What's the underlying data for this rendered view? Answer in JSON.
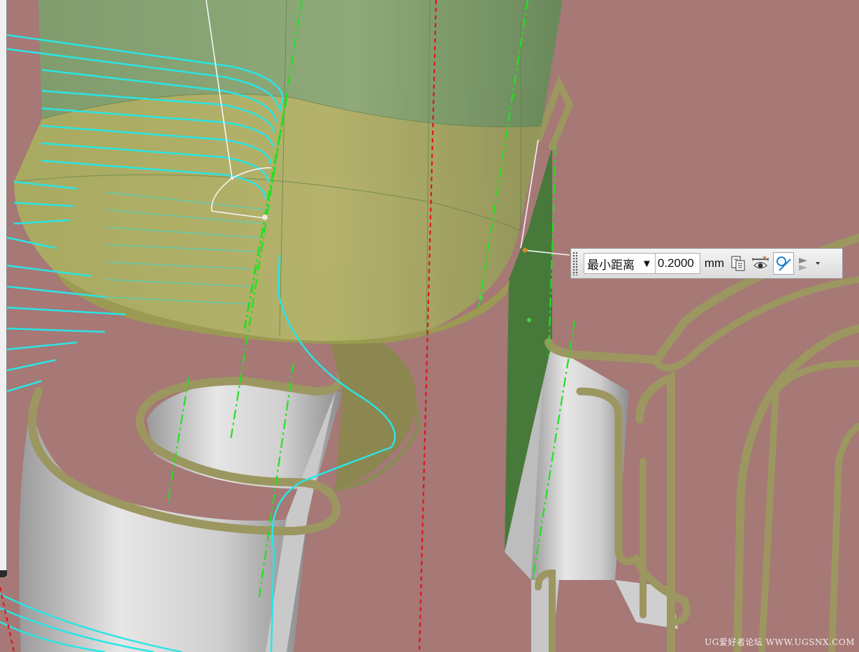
{
  "toolbar": {
    "measure_type": "最小距离",
    "measure_value": "0.2000",
    "unit": "mm",
    "icons": [
      "grip-icon",
      "clipboard-icon",
      "show-hide-icon",
      "measure-arc-icon",
      "options-dropdown-icon"
    ]
  },
  "watermark": "UG爱好者论坛 WWW.UGSNX.COM",
  "colors": {
    "background": "#a67876",
    "toolpath": "#29e5e5",
    "centerline_green": "#22e022",
    "centerline_red": "#e11616",
    "rib_olive": "#9c9660",
    "wall_gray": "#d4d4d4",
    "cutter_green": "#6a9f5e",
    "holder_yellow": "#c4c25e"
  }
}
